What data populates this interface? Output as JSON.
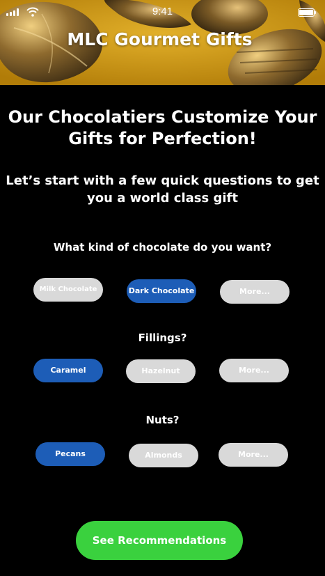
{
  "status_bar": {
    "time": "9:41"
  },
  "header": {
    "title": "MLC Gourmet Gifts",
    "background_color": "#c9920e"
  },
  "intro": {
    "headline_line1": "Our Chocolatiers Customize Your",
    "headline_line2": "Gifts for Perfection!",
    "sub_line1": "Let’s start with a few quick questions to get",
    "sub_line2": "you a world class gift"
  },
  "questions": [
    {
      "label": "What kind of chocolate do you want?",
      "options": [
        {
          "label": "Milk Chocolate",
          "selected": false
        },
        {
          "label": "Dark Chocolate",
          "selected": true
        },
        {
          "label": "More...",
          "selected": false
        }
      ]
    },
    {
      "label": "Fillings?",
      "options": [
        {
          "label": "Caramel",
          "selected": true
        },
        {
          "label": "Hazelnut",
          "selected": false
        },
        {
          "label": "More...",
          "selected": false
        }
      ]
    },
    {
      "label": "Nuts?",
      "options": [
        {
          "label": "Pecans",
          "selected": true
        },
        {
          "label": "Almonds",
          "selected": false
        },
        {
          "label": "More...",
          "selected": false
        }
      ]
    }
  ],
  "cta": {
    "label": "See Recommendations",
    "color": "#3ad13e"
  },
  "colors": {
    "selected": "#1d5db7",
    "unselected": "#d9d9d9",
    "background": "#000000"
  }
}
